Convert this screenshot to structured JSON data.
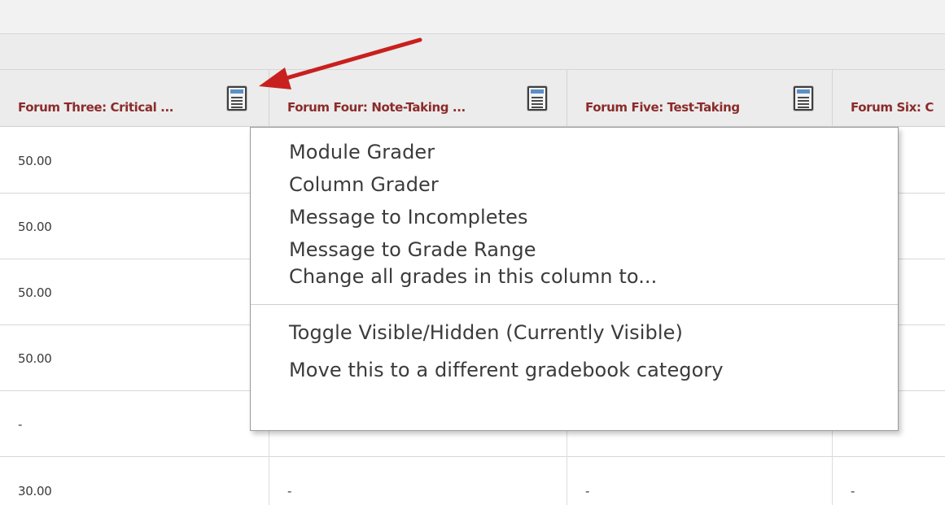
{
  "gradebook": {
    "columns": [
      {
        "title": "Forum Three: Critical ...",
        "has_menu_icon": true
      },
      {
        "title": "Forum Four: Note-Taking ...",
        "has_menu_icon": true
      },
      {
        "title": "Forum Five: Test-Taking",
        "has_menu_icon": true
      },
      {
        "title": "Forum Six: C",
        "has_menu_icon": false
      }
    ],
    "rows": [
      [
        "50.00",
        "",
        "",
        ""
      ],
      [
        "50.00",
        "",
        "",
        ""
      ],
      [
        "50.00",
        "",
        "",
        ""
      ],
      [
        "50.00",
        "",
        "",
        ""
      ],
      [
        "-",
        "",
        "",
        ""
      ],
      [
        "30.00",
        "-",
        "-",
        "-"
      ]
    ]
  },
  "column_menu": {
    "items": [
      "Module Grader",
      "Column Grader",
      "Message to Incompletes",
      "Message to Grade Range",
      "Change all grades in this column to...",
      "Toggle Visible/Hidden (Currently Visible)",
      "Move this to a different gradebook category"
    ]
  },
  "icons": {
    "column_menu_icon": "list-menu-icon",
    "pointer": "red-arrow-annotation"
  },
  "colors": {
    "header_text": "#8c2b2b",
    "arrow": "#c8201e",
    "icon_bar": "#5b8fc8"
  }
}
